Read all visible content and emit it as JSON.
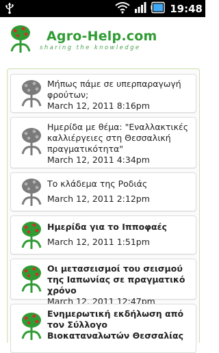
{
  "status_bar": {
    "time": "19:48",
    "icons": [
      "usb-icon",
      "wifi-icon",
      "signal-icon",
      "battery-icon"
    ]
  },
  "header": {
    "brand": "Agro-Help.com",
    "tagline": "sharing the knowledge",
    "colors": {
      "brand": "#2f9b33",
      "accent_red": "#d32f2f"
    }
  },
  "items": [
    {
      "title": "Μήπως πάμε σε υπερπαραγωγή φρούτων;",
      "date": "March 12, 2011 8:16pm",
      "icon": "tree-logo-gray-icon",
      "read": true
    },
    {
      "title": "Ημερίδα με θέμα: \"Εναλλακτικές καλλιέργειες στη Θεσσαλική πραγματικότητα\"",
      "date": "March 12, 2011 4:34pm",
      "icon": "tree-logo-gray-icon",
      "read": true
    },
    {
      "title": "Το κλάδεμα της Ροδιάς",
      "date": "March 12, 2011 2:12pm",
      "icon": "tree-logo-gray-icon",
      "read": true
    },
    {
      "title": "Ημερίδα για το Ιπποφαές",
      "date": "March 12, 2011 1:51pm",
      "icon": "tree-logo-color-icon",
      "read": false
    },
    {
      "title": "Οι μετασεισμοί του σεισμού της Ιαπωνίας σε πραγματικό χρόνο",
      "date": "March 12, 2011 12:47pm",
      "icon": "tree-logo-color-icon",
      "read": false
    },
    {
      "title": "Ενημερωτική εκδήλωση από τον Σύλλογο Βιοκαταναλωτών Θεσσαλίας",
      "date": "",
      "icon": "tree-logo-color-icon",
      "read": false
    }
  ]
}
